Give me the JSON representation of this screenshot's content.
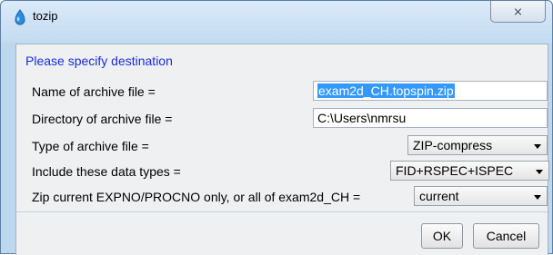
{
  "window": {
    "title": "tozip",
    "close_glyph": "⨯"
  },
  "dialog": {
    "heading": "Please specify destination",
    "archive_name": {
      "label": "Name of archive file =",
      "value": "exam2d_CH.topspin.zip"
    },
    "archive_dir": {
      "label": "Directory of archive file =",
      "value": "C:\\Users\\nmrsu"
    },
    "archive_type": {
      "label": "Type of archive file =",
      "selected": "ZIP-compress"
    },
    "data_types": {
      "label": "Include these data types =",
      "selected": "FID+RSPEC+ISPEC"
    },
    "zip_scope": {
      "label": "Zip current EXPNO/PROCNO only, or all of exam2d_CH =",
      "selected": "current"
    }
  },
  "buttons": {
    "ok": "OK",
    "cancel": "Cancel"
  },
  "colors": {
    "heading": "#1b2ed6",
    "selection": "#3399ff",
    "frame": "#bcd7ee"
  },
  "icons": {
    "title": "tozip-app-icon",
    "close": "close-icon",
    "dropdown": "chevron-down-icon"
  }
}
